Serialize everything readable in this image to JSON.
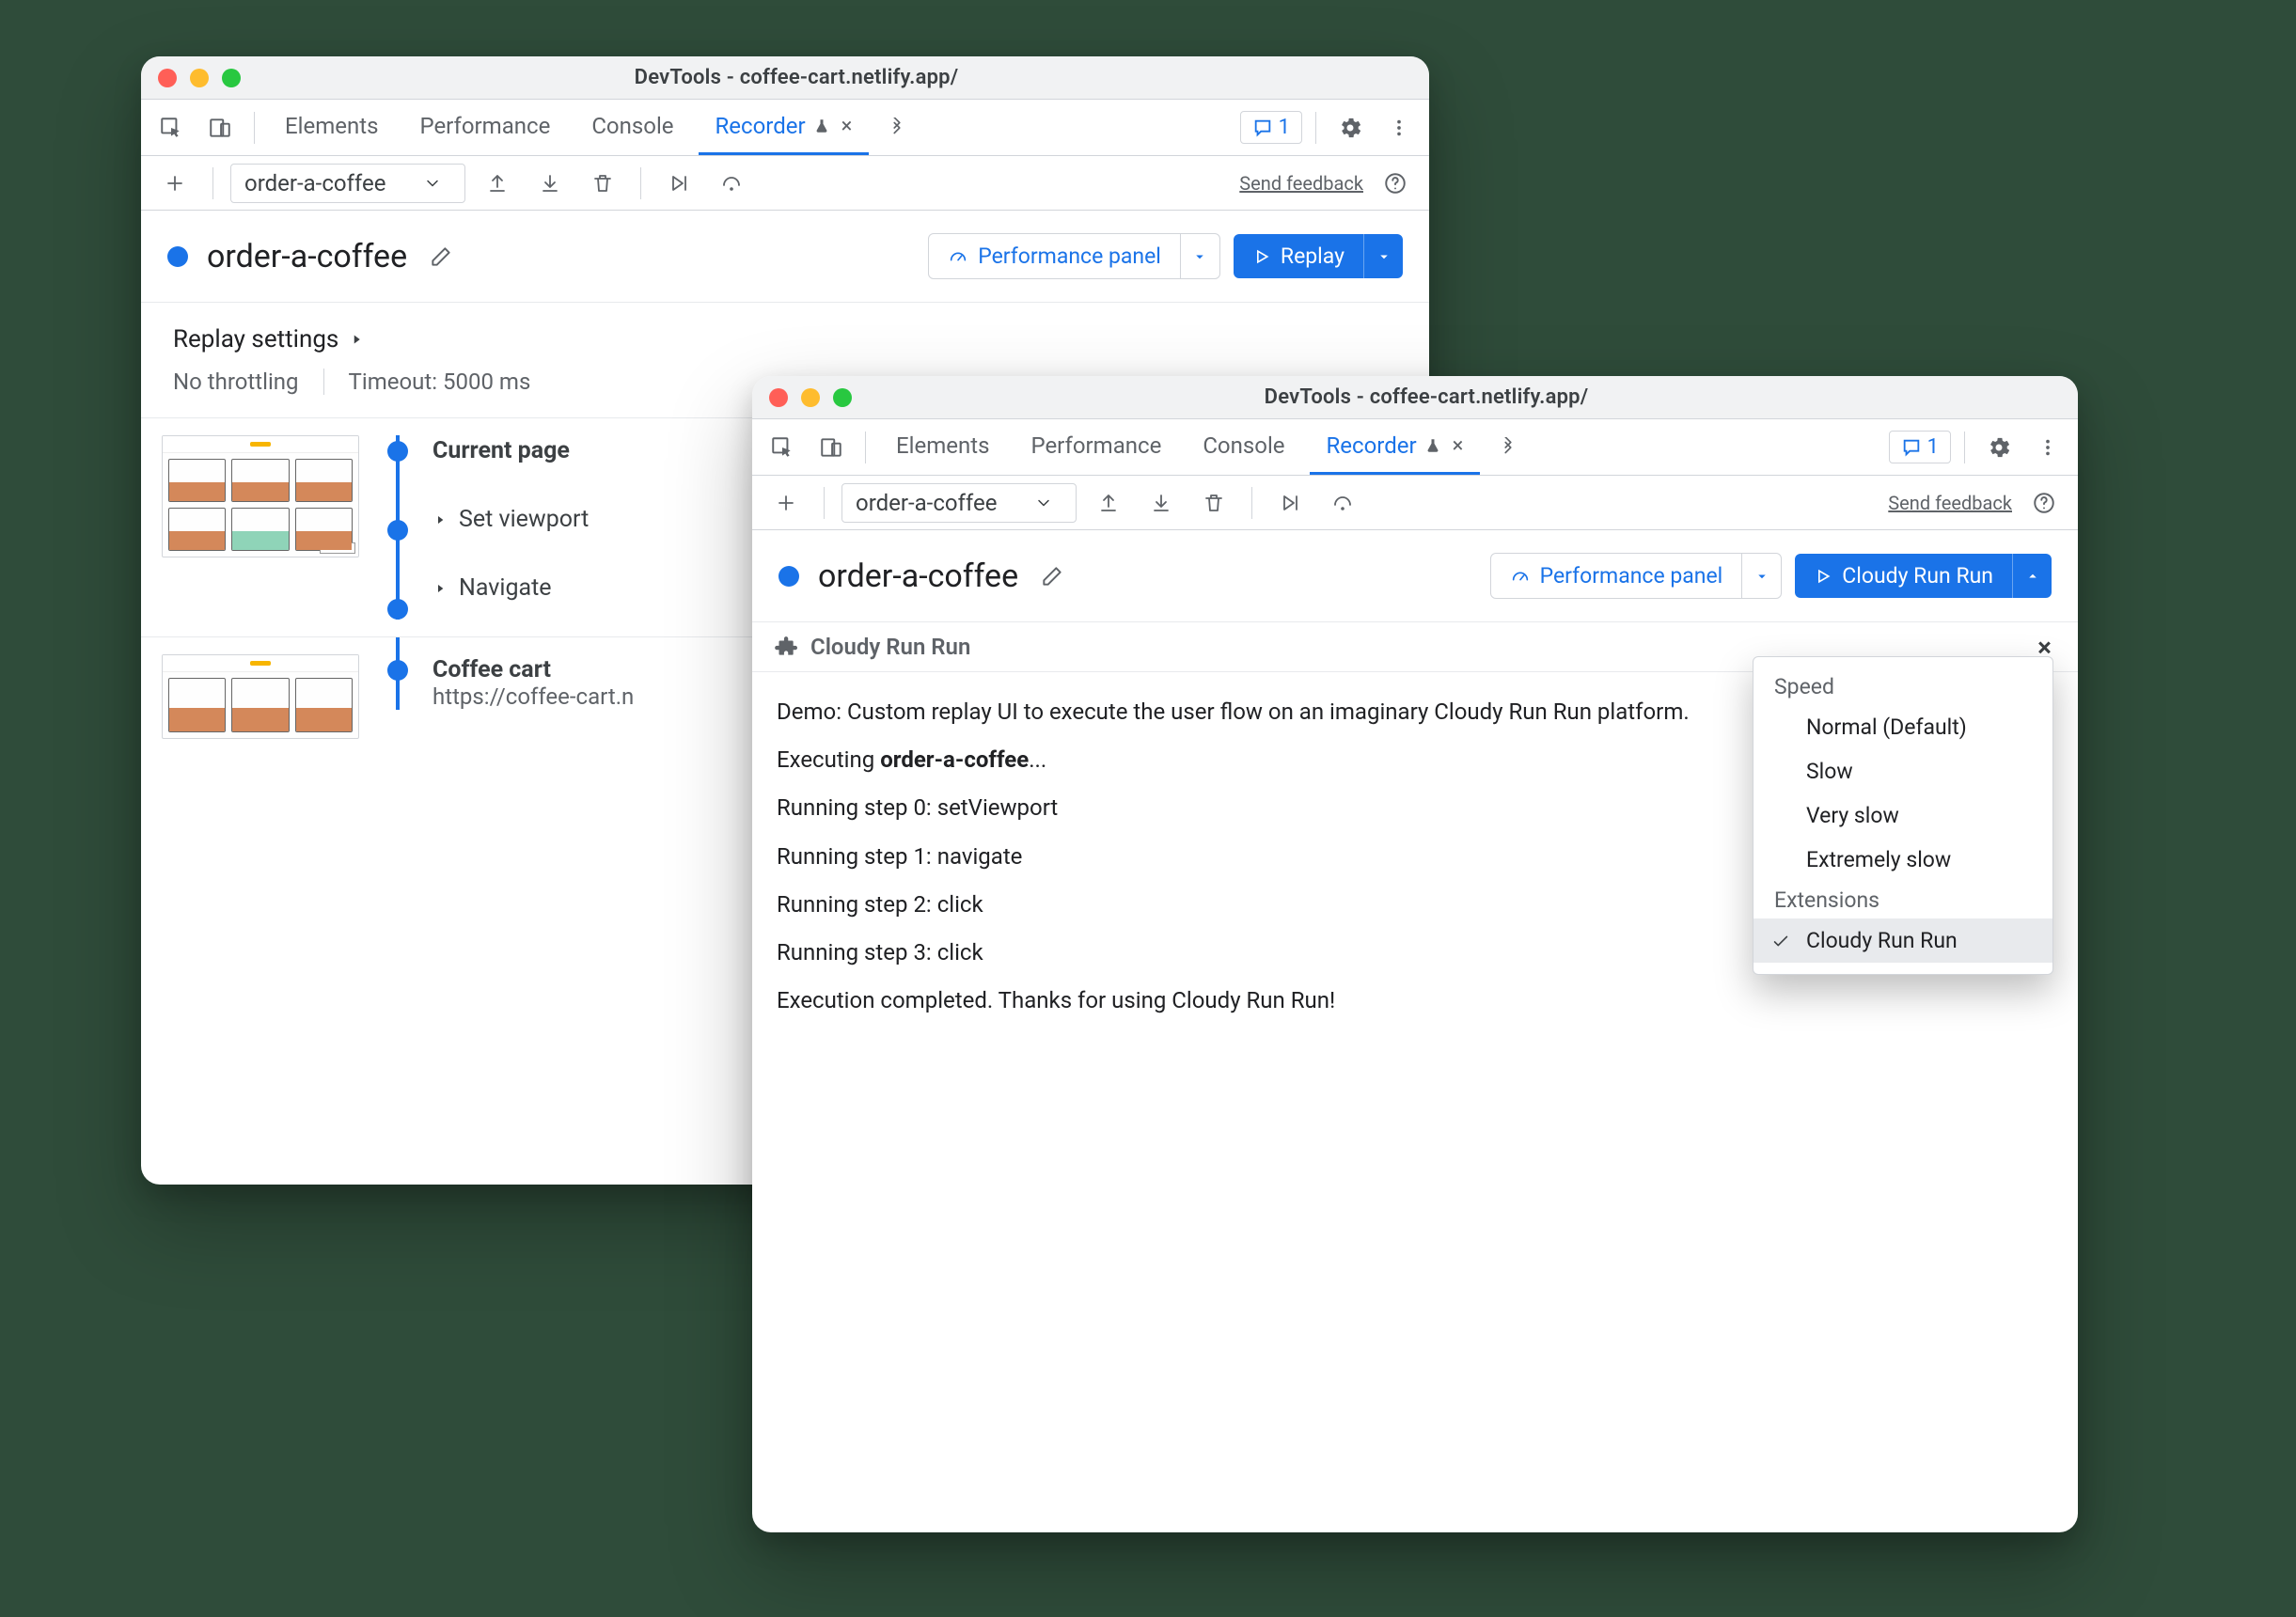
{
  "windows": {
    "back": {
      "title": "DevTools - coffee-cart.netlify.app/",
      "tabs": [
        "Elements",
        "Performance",
        "Console",
        "Recorder"
      ],
      "active_tab": "Recorder",
      "issues_count": "1",
      "toolbar": {
        "recording_select": "order-a-coffee",
        "feedback": "Send feedback"
      },
      "recording": {
        "name": "order-a-coffee",
        "perf_btn": "Performance panel",
        "replay_btn": "Replay",
        "settings_title": "Replay settings",
        "settings_throttle": "No throttling",
        "settings_timeout": "Timeout: 5000 ms",
        "steps": {
          "current": "Current page",
          "viewport": "Set viewport",
          "navigate": "Navigate",
          "section2_title": "Coffee cart",
          "section2_url": "https://coffee-cart.n"
        }
      }
    },
    "front": {
      "title": "DevTools - coffee-cart.netlify.app/",
      "tabs": [
        "Elements",
        "Performance",
        "Console",
        "Recorder"
      ],
      "active_tab": "Recorder",
      "issues_count": "1",
      "toolbar": {
        "recording_select": "order-a-coffee",
        "feedback": "Send feedback"
      },
      "recording": {
        "name": "order-a-coffee",
        "perf_btn": "Performance panel",
        "replay_btn": "Cloudy Run Run"
      },
      "ext_panel": {
        "title": "Cloudy Run Run",
        "lines": [
          "Demo: Custom replay UI to execute the user flow on an imaginary Cloudy Run Run platform.",
          "Executing <b>order-a-coffee</b>...",
          "Running step 0: setViewport",
          "Running step 1: navigate",
          "Running step 2: click",
          "Running step 3: click",
          "Execution completed. Thanks for using Cloudy Run Run!"
        ]
      },
      "menu": {
        "group1": "Speed",
        "items1": [
          "Normal (Default)",
          "Slow",
          "Very slow",
          "Extremely slow"
        ],
        "group2": "Extensions",
        "items2": [
          "Cloudy Run Run"
        ],
        "selected": "Cloudy Run Run"
      }
    }
  }
}
